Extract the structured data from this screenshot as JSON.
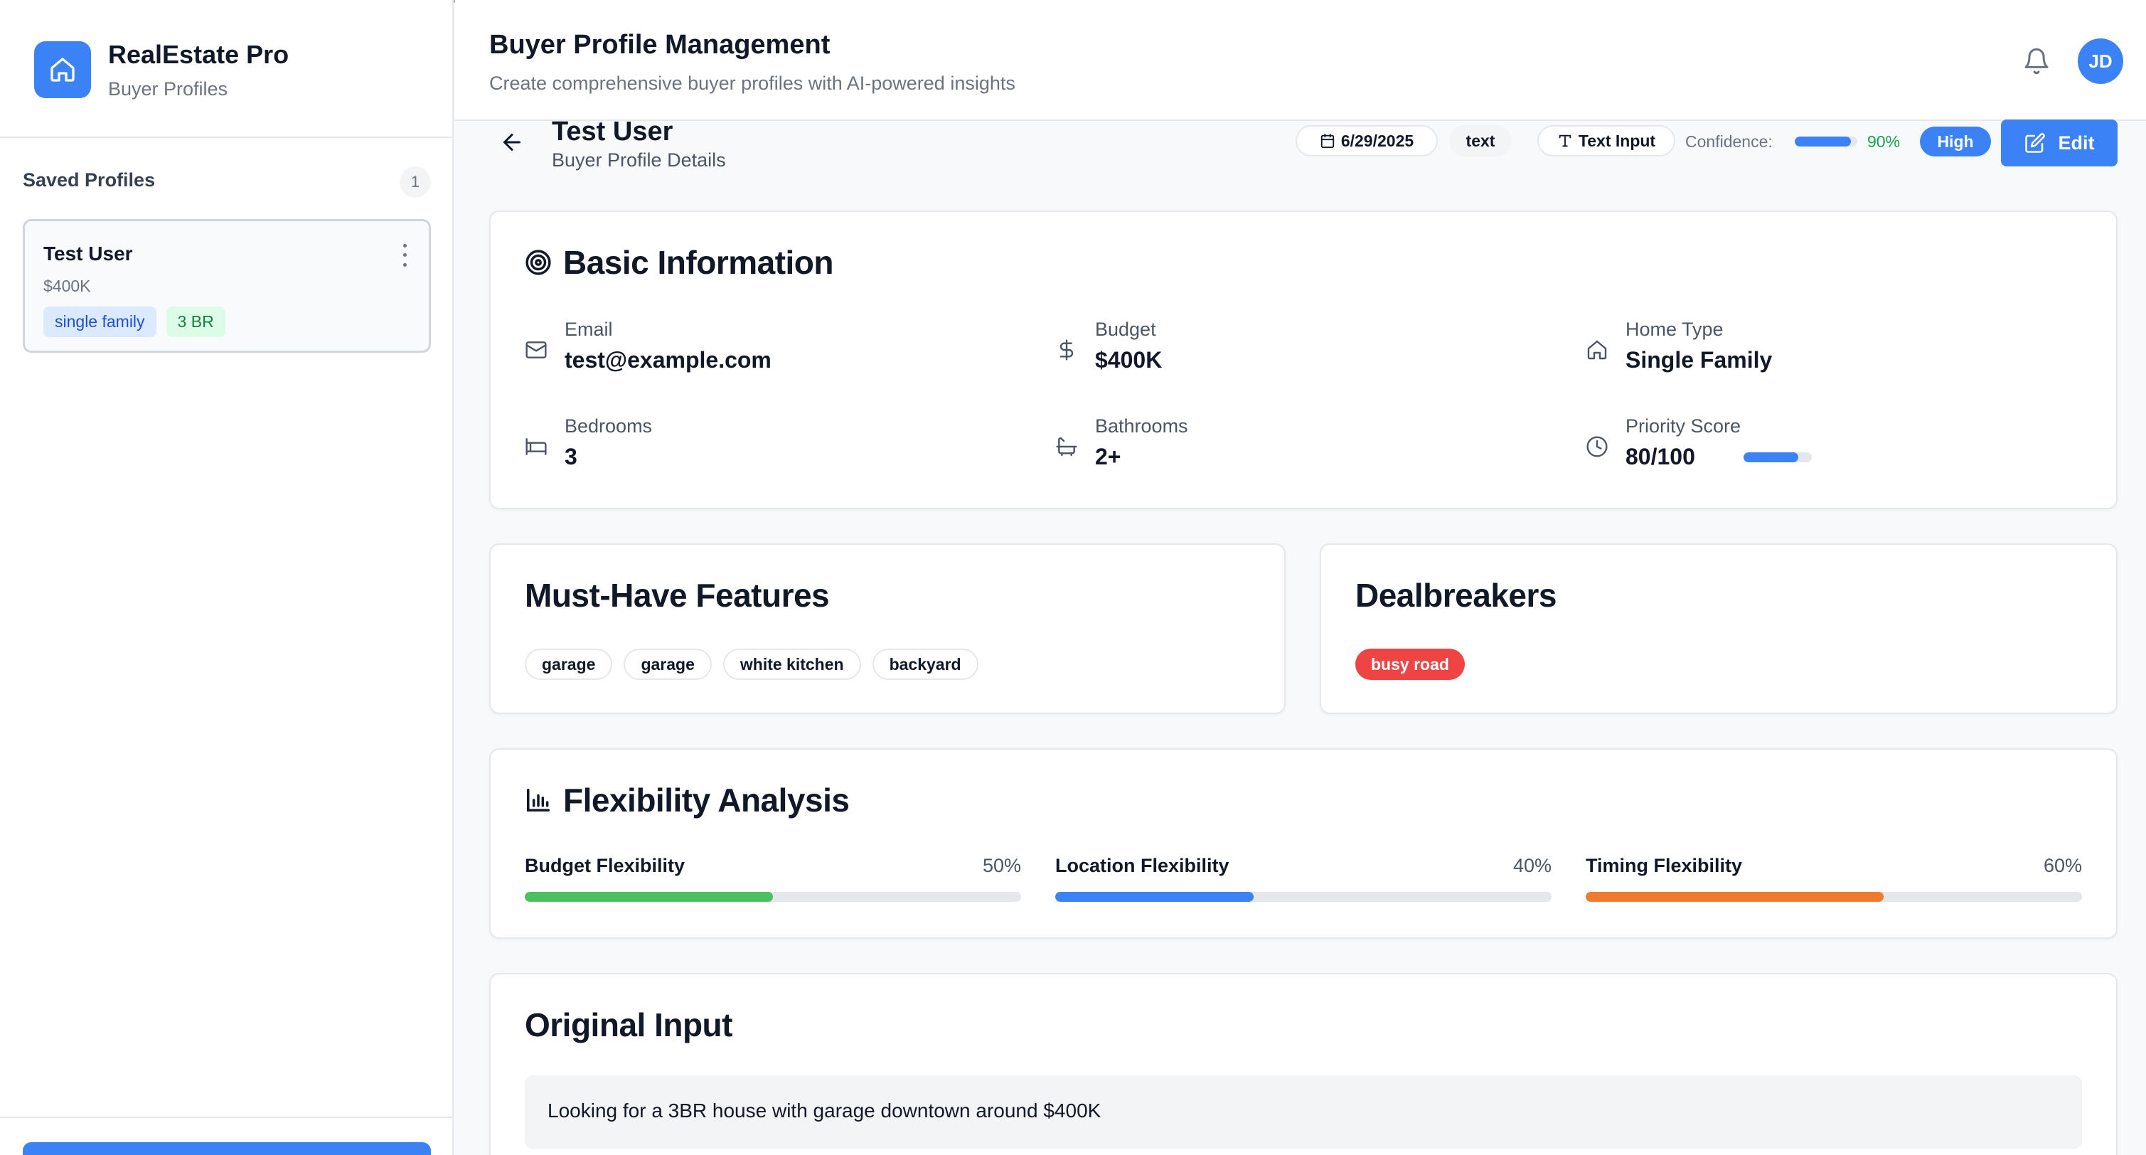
{
  "sidebar": {
    "app_name": "RealEstate Pro",
    "app_subtitle": "Buyer Profiles",
    "logo_icon": "home-icon",
    "saved_title": "Saved Profiles",
    "saved_count": "1",
    "profiles": [
      {
        "name": "Test User",
        "budget": "$400K",
        "tags": [
          "single family",
          "3 BR"
        ]
      }
    ]
  },
  "header": {
    "title": "Buyer Profile Management",
    "subtitle": "Create comprehensive buyer profiles with AI-powered insights",
    "avatar_initials": "JD"
  },
  "profile": {
    "name": "Test User",
    "subtitle": "Buyer Profile Details",
    "date": "6/29/2025",
    "input_type": "text",
    "input_method": "Text Input",
    "confidence_label": "Confidence:",
    "confidence_value": 0.9,
    "confidence_text": "90%",
    "confidence_level": "High",
    "edit_label": "Edit"
  },
  "basic_info": {
    "title": "Basic Information",
    "email_label": "Email",
    "email": "test@example.com",
    "budget_label": "Budget",
    "budget": "$400K",
    "home_type_label": "Home Type",
    "home_type": "Single Family",
    "bedrooms_label": "Bedrooms",
    "bedrooms": "3",
    "bathrooms_label": "Bathrooms",
    "bathrooms": "2+",
    "priority_label": "Priority Score",
    "priority": "80/100",
    "priority_value": 0.8
  },
  "must_have": {
    "title": "Must-Have Features",
    "items": [
      "garage",
      "garage",
      "white kitchen",
      "backyard"
    ]
  },
  "dealbreakers": {
    "title": "Dealbreakers",
    "items": [
      "busy road"
    ]
  },
  "flexibility": {
    "title": "Flexibility Analysis",
    "items": [
      {
        "label": "Budget Flexibility",
        "pct": "50%",
        "value": 0.5,
        "color": "#4cbf5f"
      },
      {
        "label": "Location Flexibility",
        "pct": "40%",
        "value": 0.4,
        "color": "#3b82f6"
      },
      {
        "label": "Timing Flexibility",
        "pct": "60%",
        "value": 0.6,
        "color": "#f07b2f"
      }
    ]
  },
  "original_input": {
    "title": "Original Input",
    "text": "Looking for a 3BR house with garage downtown around $400K"
  },
  "colors": {
    "accent": "#3b82f6",
    "success": "#16a34a",
    "danger": "#ef4444"
  }
}
